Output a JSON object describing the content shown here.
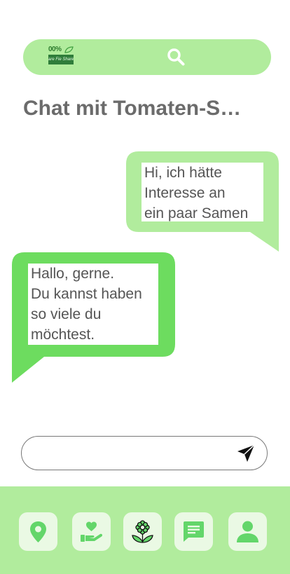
{
  "header": {
    "logo_top_text": "00%",
    "logo_banner_text": "are Fie Share",
    "search_icon": "search-icon"
  },
  "chat": {
    "title": "Chat mit Tomaten-S…",
    "messages": [
      {
        "sender": "self",
        "text": "Hi, ich hätte\nInteresse an\nein paar Samen"
      },
      {
        "sender": "other",
        "text": "Hallo, gerne.\nDu kannst haben\nso viele du\nmöchtest."
      }
    ]
  },
  "composer": {
    "value": "",
    "placeholder": "",
    "send_icon": "send-icon"
  },
  "nav": {
    "items": [
      {
        "icon": "location-pin-icon"
      },
      {
        "icon": "heart-hand-icon"
      },
      {
        "icon": "flower-icon"
      },
      {
        "icon": "chat-icon"
      },
      {
        "icon": "profile-icon"
      }
    ]
  },
  "colors": {
    "bar_green": "#b1ec9d",
    "bubble_sent": "#b1ec9d",
    "bubble_received": "#6ddc5f",
    "nav_button_bg": "#eaf9e4",
    "title_gray": "#6b6b6b"
  }
}
